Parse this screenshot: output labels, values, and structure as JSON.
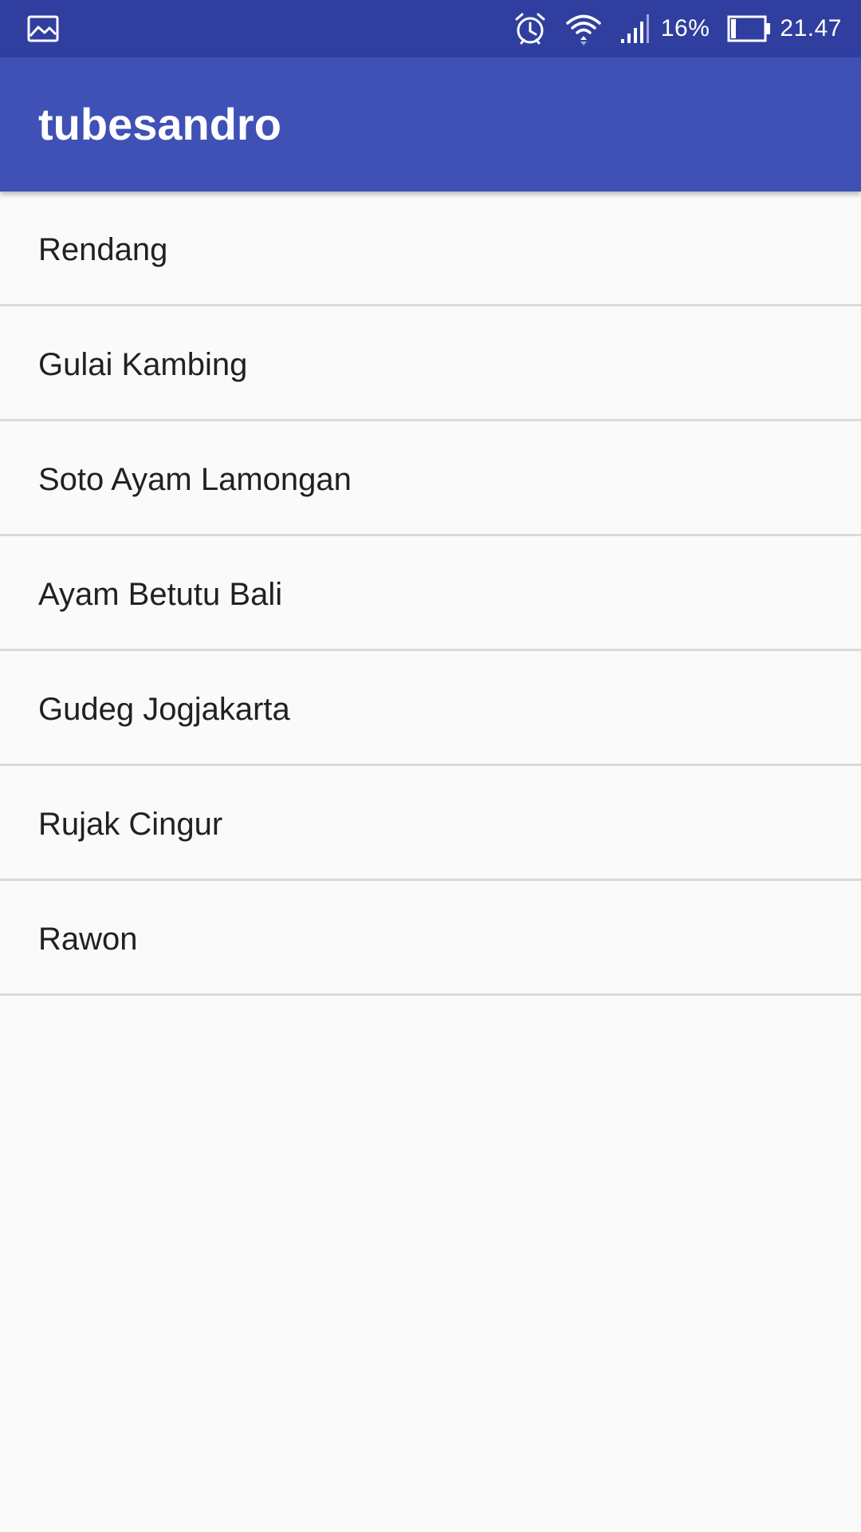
{
  "status_bar": {
    "left_icon": "gallery-notification-icon",
    "icons": [
      "alarm-icon",
      "wifi-icon",
      "cellular-signal-icon",
      "battery-icon"
    ],
    "battery_percent": "16%",
    "battery_level": 0.16,
    "time": "21.47",
    "color": "#303f9f"
  },
  "app_bar": {
    "title": "tubesandro",
    "color": "#3f51b5"
  },
  "list": {
    "items": [
      {
        "label": "Rendang"
      },
      {
        "label": "Gulai Kambing"
      },
      {
        "label": "Soto Ayam Lamongan"
      },
      {
        "label": "Ayam Betutu Bali"
      },
      {
        "label": "Gudeg Jogjakarta"
      },
      {
        "label": "Rujak Cingur"
      },
      {
        "label": "Rawon"
      }
    ]
  }
}
